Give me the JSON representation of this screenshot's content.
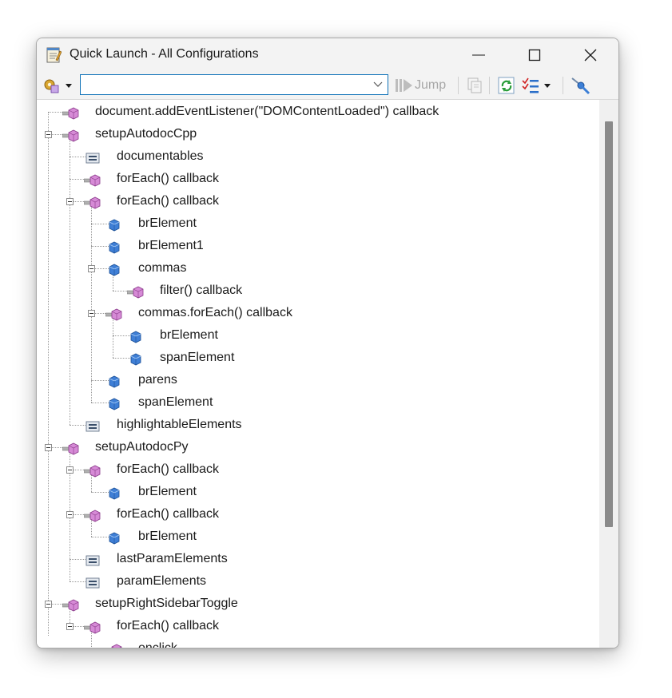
{
  "window": {
    "title": "Quick Launch - All Configurations"
  },
  "toolbar": {
    "search_value": "",
    "jump_label": "Jump"
  },
  "tree": [
    {
      "depth": 0,
      "label": "document.addEventListener(\"DOMContentLoaded\") callback",
      "icon": "function-icon",
      "expand": false
    },
    {
      "depth": 0,
      "label": "setupAutodocCpp",
      "icon": "function-icon",
      "expand": true
    },
    {
      "depth": 1,
      "label": "documentables",
      "icon": "variable-icon",
      "expand": false
    },
    {
      "depth": 1,
      "label": "forEach() callback",
      "icon": "function-icon",
      "expand": false
    },
    {
      "depth": 1,
      "label": "forEach() callback",
      "icon": "function-icon",
      "expand": true
    },
    {
      "depth": 2,
      "label": "brElement",
      "icon": "field-icon",
      "expand": false
    },
    {
      "depth": 2,
      "label": "brElement1",
      "icon": "field-icon",
      "expand": false
    },
    {
      "depth": 2,
      "label": "commas",
      "icon": "field-icon",
      "expand": true
    },
    {
      "depth": 3,
      "label": "filter() callback",
      "icon": "function-icon",
      "expand": false
    },
    {
      "depth": 2,
      "label": "commas.forEach() callback",
      "icon": "function-icon",
      "expand": true
    },
    {
      "depth": 3,
      "label": "brElement",
      "icon": "field-icon",
      "expand": false
    },
    {
      "depth": 3,
      "label": "spanElement",
      "icon": "field-icon",
      "expand": false
    },
    {
      "depth": 2,
      "label": "parens",
      "icon": "field-icon",
      "expand": false
    },
    {
      "depth": 2,
      "label": "spanElement",
      "icon": "field-icon",
      "expand": false
    },
    {
      "depth": 1,
      "label": "highlightableElements",
      "icon": "variable-icon",
      "expand": false
    },
    {
      "depth": 0,
      "label": "setupAutodocPy",
      "icon": "function-icon",
      "expand": true
    },
    {
      "depth": 1,
      "label": "forEach() callback",
      "icon": "function-icon",
      "expand": true
    },
    {
      "depth": 2,
      "label": "brElement",
      "icon": "field-icon",
      "expand": false
    },
    {
      "depth": 1,
      "label": "forEach() callback",
      "icon": "function-icon",
      "expand": true
    },
    {
      "depth": 2,
      "label": "brElement",
      "icon": "field-icon",
      "expand": false
    },
    {
      "depth": 1,
      "label": "lastParamElements",
      "icon": "variable-icon",
      "expand": false
    },
    {
      "depth": 1,
      "label": "paramElements",
      "icon": "variable-icon",
      "expand": false
    },
    {
      "depth": 0,
      "label": "setupRightSidebarToggle",
      "icon": "function-icon",
      "expand": true
    },
    {
      "depth": 1,
      "label": "forEach() callback",
      "icon": "function-icon",
      "expand": true
    },
    {
      "depth": 2,
      "label": "onclick",
      "icon": "function-icon",
      "expand": false
    }
  ]
}
